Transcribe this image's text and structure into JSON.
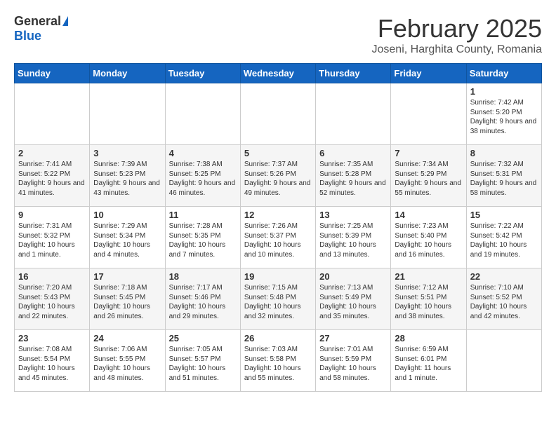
{
  "logo": {
    "general": "General",
    "blue": "Blue"
  },
  "title": "February 2025",
  "subtitle": "Joseni, Harghita County, Romania",
  "days_of_week": [
    "Sunday",
    "Monday",
    "Tuesday",
    "Wednesday",
    "Thursday",
    "Friday",
    "Saturday"
  ],
  "weeks": [
    [
      {
        "day": "",
        "info": ""
      },
      {
        "day": "",
        "info": ""
      },
      {
        "day": "",
        "info": ""
      },
      {
        "day": "",
        "info": ""
      },
      {
        "day": "",
        "info": ""
      },
      {
        "day": "",
        "info": ""
      },
      {
        "day": "1",
        "info": "Sunrise: 7:42 AM\nSunset: 5:20 PM\nDaylight: 9 hours and 38 minutes."
      }
    ],
    [
      {
        "day": "2",
        "info": "Sunrise: 7:41 AM\nSunset: 5:22 PM\nDaylight: 9 hours and 41 minutes."
      },
      {
        "day": "3",
        "info": "Sunrise: 7:39 AM\nSunset: 5:23 PM\nDaylight: 9 hours and 43 minutes."
      },
      {
        "day": "4",
        "info": "Sunrise: 7:38 AM\nSunset: 5:25 PM\nDaylight: 9 hours and 46 minutes."
      },
      {
        "day": "5",
        "info": "Sunrise: 7:37 AM\nSunset: 5:26 PM\nDaylight: 9 hours and 49 minutes."
      },
      {
        "day": "6",
        "info": "Sunrise: 7:35 AM\nSunset: 5:28 PM\nDaylight: 9 hours and 52 minutes."
      },
      {
        "day": "7",
        "info": "Sunrise: 7:34 AM\nSunset: 5:29 PM\nDaylight: 9 hours and 55 minutes."
      },
      {
        "day": "8",
        "info": "Sunrise: 7:32 AM\nSunset: 5:31 PM\nDaylight: 9 hours and 58 minutes."
      }
    ],
    [
      {
        "day": "9",
        "info": "Sunrise: 7:31 AM\nSunset: 5:32 PM\nDaylight: 10 hours and 1 minute."
      },
      {
        "day": "10",
        "info": "Sunrise: 7:29 AM\nSunset: 5:34 PM\nDaylight: 10 hours and 4 minutes."
      },
      {
        "day": "11",
        "info": "Sunrise: 7:28 AM\nSunset: 5:35 PM\nDaylight: 10 hours and 7 minutes."
      },
      {
        "day": "12",
        "info": "Sunrise: 7:26 AM\nSunset: 5:37 PM\nDaylight: 10 hours and 10 minutes."
      },
      {
        "day": "13",
        "info": "Sunrise: 7:25 AM\nSunset: 5:39 PM\nDaylight: 10 hours and 13 minutes."
      },
      {
        "day": "14",
        "info": "Sunrise: 7:23 AM\nSunset: 5:40 PM\nDaylight: 10 hours and 16 minutes."
      },
      {
        "day": "15",
        "info": "Sunrise: 7:22 AM\nSunset: 5:42 PM\nDaylight: 10 hours and 19 minutes."
      }
    ],
    [
      {
        "day": "16",
        "info": "Sunrise: 7:20 AM\nSunset: 5:43 PM\nDaylight: 10 hours and 22 minutes."
      },
      {
        "day": "17",
        "info": "Sunrise: 7:18 AM\nSunset: 5:45 PM\nDaylight: 10 hours and 26 minutes."
      },
      {
        "day": "18",
        "info": "Sunrise: 7:17 AM\nSunset: 5:46 PM\nDaylight: 10 hours and 29 minutes."
      },
      {
        "day": "19",
        "info": "Sunrise: 7:15 AM\nSunset: 5:48 PM\nDaylight: 10 hours and 32 minutes."
      },
      {
        "day": "20",
        "info": "Sunrise: 7:13 AM\nSunset: 5:49 PM\nDaylight: 10 hours and 35 minutes."
      },
      {
        "day": "21",
        "info": "Sunrise: 7:12 AM\nSunset: 5:51 PM\nDaylight: 10 hours and 38 minutes."
      },
      {
        "day": "22",
        "info": "Sunrise: 7:10 AM\nSunset: 5:52 PM\nDaylight: 10 hours and 42 minutes."
      }
    ],
    [
      {
        "day": "23",
        "info": "Sunrise: 7:08 AM\nSunset: 5:54 PM\nDaylight: 10 hours and 45 minutes."
      },
      {
        "day": "24",
        "info": "Sunrise: 7:06 AM\nSunset: 5:55 PM\nDaylight: 10 hours and 48 minutes."
      },
      {
        "day": "25",
        "info": "Sunrise: 7:05 AM\nSunset: 5:57 PM\nDaylight: 10 hours and 51 minutes."
      },
      {
        "day": "26",
        "info": "Sunrise: 7:03 AM\nSunset: 5:58 PM\nDaylight: 10 hours and 55 minutes."
      },
      {
        "day": "27",
        "info": "Sunrise: 7:01 AM\nSunset: 5:59 PM\nDaylight: 10 hours and 58 minutes."
      },
      {
        "day": "28",
        "info": "Sunrise: 6:59 AM\nSunset: 6:01 PM\nDaylight: 11 hours and 1 minute."
      },
      {
        "day": "",
        "info": ""
      }
    ]
  ]
}
